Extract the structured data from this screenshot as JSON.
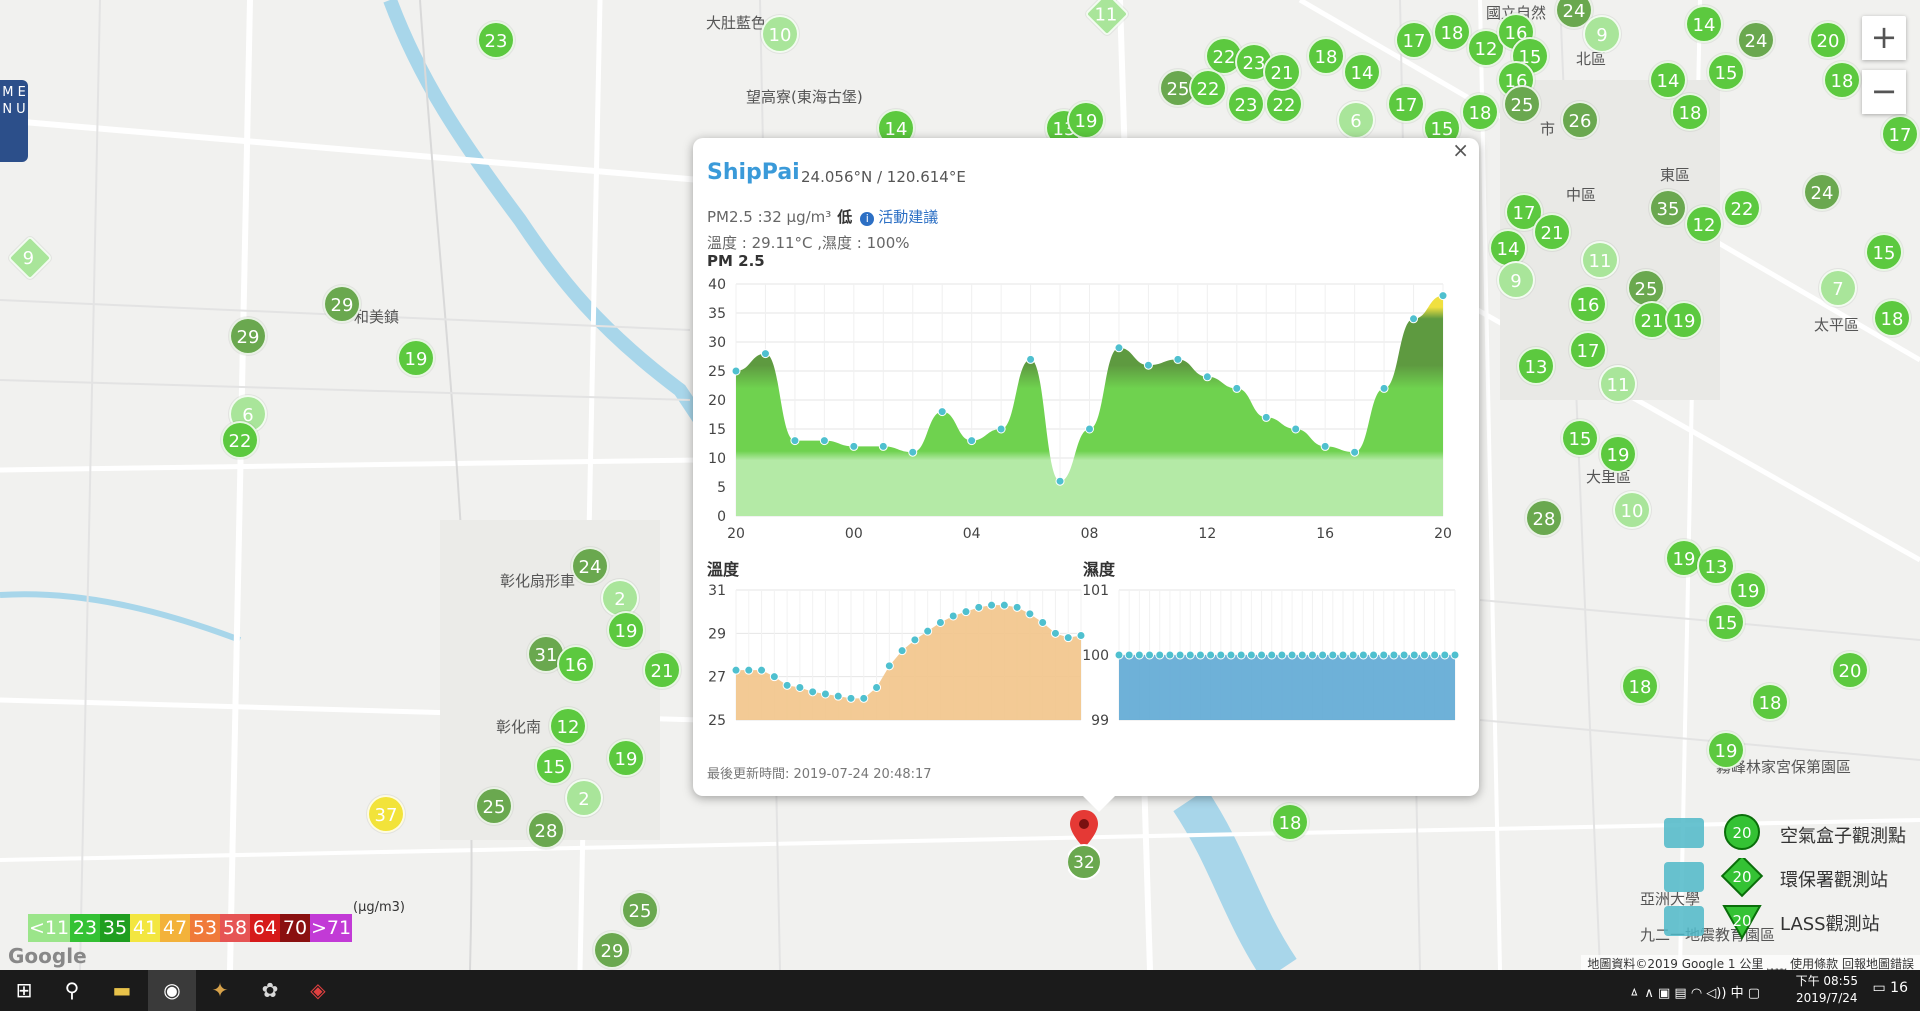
{
  "menu": {
    "label": "M E N U"
  },
  "zoom": {
    "in": "+",
    "out": "−"
  },
  "places": [
    {
      "text": "大肚藍色",
      "x": 706,
      "y": 12
    },
    {
      "text": "望高寮(東海古堡)",
      "x": 746,
      "y": 86
    },
    {
      "text": "和美鎮",
      "x": 354,
      "y": 306
    },
    {
      "text": "彰化扇形車",
      "x": 500,
      "y": 570
    },
    {
      "text": "彰化南",
      "x": 496,
      "y": 716
    },
    {
      "text": "北區",
      "x": 1576,
      "y": 48
    },
    {
      "text": "市",
      "x": 1540,
      "y": 118
    },
    {
      "text": "東區",
      "x": 1660,
      "y": 164
    },
    {
      "text": "中區",
      "x": 1566,
      "y": 184
    },
    {
      "text": "太平區",
      "x": 1814,
      "y": 314
    },
    {
      "text": "大里區",
      "x": 1586,
      "y": 466
    },
    {
      "text": "亞洲大學",
      "x": 1640,
      "y": 888
    },
    {
      "text": "九二一地震教育園區",
      "x": 1640,
      "y": 924
    },
    {
      "text": "霧峰林家宮保第園區",
      "x": 1716,
      "y": 756
    },
    {
      "text": "國立自然",
      "x": 1486,
      "y": 2
    }
  ],
  "markers": [
    {
      "v": "23",
      "x": 496,
      "y": 40,
      "c": "green"
    },
    {
      "v": "10",
      "x": 780,
      "y": 34,
      "c": "light"
    },
    {
      "v": "11",
      "x": 1107,
      "y": 14,
      "c": "light",
      "shape": "diamond"
    },
    {
      "v": "14",
      "x": 896,
      "y": 128,
      "c": "green"
    },
    {
      "v": "13",
      "x": 1064,
      "y": 128,
      "c": "green"
    },
    {
      "v": "19",
      "x": 1086,
      "y": 120,
      "c": "green"
    },
    {
      "v": "22",
      "x": 1224,
      "y": 56,
      "c": "green"
    },
    {
      "v": "23",
      "x": 1254,
      "y": 62,
      "c": "green"
    },
    {
      "v": "25",
      "x": 1178,
      "y": 88,
      "c": "dark"
    },
    {
      "v": "22",
      "x": 1208,
      "y": 88,
      "c": "green"
    },
    {
      "v": "23",
      "x": 1246,
      "y": 104,
      "c": "green"
    },
    {
      "v": "22",
      "x": 1284,
      "y": 104,
      "c": "green"
    },
    {
      "v": "21",
      "x": 1282,
      "y": 72,
      "c": "green"
    },
    {
      "v": "18",
      "x": 1326,
      "y": 56,
      "c": "green"
    },
    {
      "v": "14",
      "x": 1362,
      "y": 72,
      "c": "green"
    },
    {
      "v": "6",
      "x": 1356,
      "y": 120,
      "c": "light"
    },
    {
      "v": "17",
      "x": 1406,
      "y": 104,
      "c": "green"
    },
    {
      "v": "17",
      "x": 1414,
      "y": 40,
      "c": "green"
    },
    {
      "v": "18",
      "x": 1452,
      "y": 32,
      "c": "green"
    },
    {
      "v": "12",
      "x": 1486,
      "y": 48,
      "c": "green"
    },
    {
      "v": "16",
      "x": 1516,
      "y": 32,
      "c": "green"
    },
    {
      "v": "15",
      "x": 1530,
      "y": 56,
      "c": "green"
    },
    {
      "v": "16",
      "x": 1516,
      "y": 80,
      "c": "green"
    },
    {
      "v": "18",
      "x": 1480,
      "y": 112,
      "c": "green"
    },
    {
      "v": "25",
      "x": 1522,
      "y": 104,
      "c": "dark"
    },
    {
      "v": "15",
      "x": 1442,
      "y": 128,
      "c": "green"
    },
    {
      "v": "24",
      "x": 1574,
      "y": 10,
      "c": "dark"
    },
    {
      "v": "9",
      "x": 1602,
      "y": 34,
      "c": "light"
    },
    {
      "v": "26",
      "x": 1580,
      "y": 120,
      "c": "dark"
    },
    {
      "v": "14",
      "x": 1704,
      "y": 24,
      "c": "green"
    },
    {
      "v": "24",
      "x": 1756,
      "y": 40,
      "c": "dark"
    },
    {
      "v": "20",
      "x": 1828,
      "y": 40,
      "c": "green"
    },
    {
      "v": "18",
      "x": 1842,
      "y": 80,
      "c": "green"
    },
    {
      "v": "15",
      "x": 1726,
      "y": 72,
      "c": "green"
    },
    {
      "v": "14",
      "x": 1668,
      "y": 80,
      "c": "green"
    },
    {
      "v": "18",
      "x": 1690,
      "y": 112,
      "c": "green"
    },
    {
      "v": "17",
      "x": 1900,
      "y": 134,
      "c": "green"
    },
    {
      "v": "24",
      "x": 1822,
      "y": 192,
      "c": "dark"
    },
    {
      "v": "35",
      "x": 1668,
      "y": 208,
      "c": "dark"
    },
    {
      "v": "12",
      "x": 1704,
      "y": 224,
      "c": "green"
    },
    {
      "v": "22",
      "x": 1742,
      "y": 208,
      "c": "green"
    },
    {
      "v": "15",
      "x": 1884,
      "y": 252,
      "c": "green"
    },
    {
      "v": "7",
      "x": 1838,
      "y": 288,
      "c": "light"
    },
    {
      "v": "18",
      "x": 1892,
      "y": 318,
      "c": "green"
    },
    {
      "v": "17",
      "x": 1524,
      "y": 212,
      "c": "green"
    },
    {
      "v": "21",
      "x": 1552,
      "y": 232,
      "c": "green"
    },
    {
      "v": "14",
      "x": 1508,
      "y": 248,
      "c": "green"
    },
    {
      "v": "11",
      "x": 1600,
      "y": 260,
      "c": "light"
    },
    {
      "v": "9",
      "x": 1516,
      "y": 280,
      "c": "light"
    },
    {
      "v": "16",
      "x": 1588,
      "y": 304,
      "c": "green"
    },
    {
      "v": "25",
      "x": 1646,
      "y": 288,
      "c": "dark"
    },
    {
      "v": "21",
      "x": 1652,
      "y": 320,
      "c": "green"
    },
    {
      "v": "19",
      "x": 1684,
      "y": 320,
      "c": "green"
    },
    {
      "v": "17",
      "x": 1588,
      "y": 350,
      "c": "green"
    },
    {
      "v": "13",
      "x": 1536,
      "y": 366,
      "c": "green"
    },
    {
      "v": "11",
      "x": 1618,
      "y": 384,
      "c": "light"
    },
    {
      "v": "15",
      "x": 1580,
      "y": 438,
      "c": "green"
    },
    {
      "v": "19",
      "x": 1618,
      "y": 454,
      "c": "green"
    },
    {
      "v": "28",
      "x": 1544,
      "y": 518,
      "c": "dark"
    },
    {
      "v": "10",
      "x": 1632,
      "y": 510,
      "c": "light"
    },
    {
      "v": "19",
      "x": 1684,
      "y": 558,
      "c": "green"
    },
    {
      "v": "13",
      "x": 1716,
      "y": 566,
      "c": "green"
    },
    {
      "v": "19",
      "x": 1748,
      "y": 590,
      "c": "green"
    },
    {
      "v": "15",
      "x": 1726,
      "y": 622,
      "c": "green"
    },
    {
      "v": "18",
      "x": 1640,
      "y": 686,
      "c": "green"
    },
    {
      "v": "20",
      "x": 1850,
      "y": 670,
      "c": "green"
    },
    {
      "v": "18",
      "x": 1770,
      "y": 702,
      "c": "green"
    },
    {
      "v": "19",
      "x": 1726,
      "y": 750,
      "c": "green"
    },
    {
      "v": "18",
      "x": 1290,
      "y": 822,
      "c": "green"
    },
    {
      "v": "9",
      "x": 30,
      "y": 258,
      "c": "light",
      "shape": "diamond"
    },
    {
      "v": "29",
      "x": 342,
      "y": 304,
      "c": "dark"
    },
    {
      "v": "29",
      "x": 248,
      "y": 336,
      "c": "dark"
    },
    {
      "v": "19",
      "x": 416,
      "y": 358,
      "c": "green"
    },
    {
      "v": "6",
      "x": 248,
      "y": 414,
      "c": "light"
    },
    {
      "v": "22",
      "x": 240,
      "y": 440,
      "c": "green"
    },
    {
      "v": "24",
      "x": 590,
      "y": 566,
      "c": "dark"
    },
    {
      "v": "2",
      "x": 620,
      "y": 598,
      "c": "light"
    },
    {
      "v": "19",
      "x": 626,
      "y": 630,
      "c": "green"
    },
    {
      "v": "31",
      "x": 546,
      "y": 654,
      "c": "dark"
    },
    {
      "v": "16",
      "x": 576,
      "y": 664,
      "c": "green"
    },
    {
      "v": "21",
      "x": 662,
      "y": 670,
      "c": "green"
    },
    {
      "v": "12",
      "x": 568,
      "y": 726,
      "c": "green"
    },
    {
      "v": "15",
      "x": 554,
      "y": 766,
      "c": "green"
    },
    {
      "v": "2",
      "x": 584,
      "y": 798,
      "c": "light"
    },
    {
      "v": "19",
      "x": 626,
      "y": 758,
      "c": "green"
    },
    {
      "v": "25",
      "x": 494,
      "y": 806,
      "c": "dark"
    },
    {
      "v": "28",
      "x": 546,
      "y": 830,
      "c": "dark"
    },
    {
      "v": "37",
      "x": 386,
      "y": 814,
      "c": "yellow"
    },
    {
      "v": "25",
      "x": 640,
      "y": 910,
      "c": "dark"
    },
    {
      "v": "29",
      "x": 612,
      "y": 950,
      "c": "dark"
    }
  ],
  "popup": {
    "close": "×",
    "name": "ShipPai",
    "coords": "24.056°N / 120.614°E",
    "pm_text": "PM2.5 :32 μg/m³",
    "pm_level": "低",
    "info_icon": "i",
    "advice": "活動建議",
    "temp_hum": "溫度 : 29.11°C ,濕度 : 100%",
    "pm_title": "PM 2.5",
    "temp_title": "溫度",
    "hum_title": "濕度",
    "updated": "最後更新時間: 2019-07-24 20:48:17"
  },
  "pin_value": "32",
  "scale": [
    {
      "label": "<11",
      "color": "#9be58a"
    },
    {
      "label": "23",
      "color": "#34c234"
    },
    {
      "label": "35",
      "color": "#1f9e1f"
    },
    {
      "label": "41",
      "color": "#f3e640"
    },
    {
      "label": "47",
      "color": "#f3b23a"
    },
    {
      "label": "53",
      "color": "#f07a3a"
    },
    {
      "label": "58",
      "color": "#e65454"
    },
    {
      "label": "64",
      "color": "#d61a1a"
    },
    {
      "label": "70",
      "color": "#8a1010"
    },
    {
      "label": ">71",
      "color": "#c23ad6"
    }
  ],
  "scale_unit": "(μg/m3)",
  "legend": [
    {
      "value": "20",
      "text": "空氣盒子觀測點",
      "shape": "circle"
    },
    {
      "value": "20",
      "text": "環保署觀測站",
      "shape": "diamond"
    },
    {
      "value": "20",
      "text": "LASS觀測站",
      "shape": "triangle"
    }
  ],
  "google": "Google",
  "credits": "地圖資料©2019 Google   1 公里 ⎵⎵⎵⎵   使用條款   回報地圖錯誤",
  "taskbar": {
    "time": "下午 08:55",
    "date": "2019/7/24",
    "tray": "ㅿ  ∧  ▣  ▤  ◠  ◁))  中  ▢",
    "notif": "16"
  },
  "chart_data": [
    {
      "type": "area",
      "title": "PM 2.5",
      "xlabel": "",
      "ylabel": "",
      "x_ticks": [
        "20",
        "00",
        "04",
        "08",
        "12",
        "16",
        "20"
      ],
      "ylim": [
        0,
        40
      ],
      "y_ticks": [
        0,
        5,
        10,
        15,
        20,
        25,
        30,
        35,
        40
      ],
      "x_hours": [
        20,
        21,
        22,
        23,
        24,
        25,
        26,
        27,
        28,
        29,
        30,
        31,
        32,
        33,
        34,
        35,
        36,
        37,
        38,
        39,
        40,
        41,
        42,
        43,
        44
      ],
      "values": [
        25,
        28,
        13,
        13,
        12,
        12,
        11,
        18,
        13,
        15,
        27,
        6,
        15,
        29,
        26,
        27,
        24,
        22,
        17,
        15,
        12,
        11,
        22,
        34,
        38
      ],
      "band_colors": {
        "0-10": "#aee8a0",
        "10-23": "#6fd24f",
        "23-35": "#5a9a3e",
        "35-41": "#f3e640"
      }
    },
    {
      "type": "area",
      "title": "溫度",
      "xlabel": "",
      "ylabel": "",
      "ylim": [
        25,
        31
      ],
      "y_ticks": [
        25,
        27,
        29,
        31
      ],
      "values": [
        27.3,
        27.3,
        27.3,
        27.0,
        26.6,
        26.5,
        26.3,
        26.2,
        26.1,
        26.0,
        26.0,
        26.5,
        27.5,
        28.2,
        28.7,
        29.1,
        29.5,
        29.8,
        30.0,
        30.2,
        30.3,
        30.3,
        30.2,
        29.9,
        29.5,
        29.0,
        28.8,
        28.9
      ],
      "fill": "#f2c48a"
    },
    {
      "type": "area",
      "title": "濕度",
      "xlabel": "",
      "ylabel": "",
      "ylim": [
        99,
        101
      ],
      "y_ticks": [
        99,
        100,
        101
      ],
      "values": [
        100,
        100,
        100,
        100,
        100,
        100,
        100,
        100,
        100,
        100,
        100,
        100,
        100,
        100,
        100,
        100,
        100,
        100,
        100,
        100,
        100,
        100,
        100,
        100,
        100,
        100,
        100,
        100,
        100,
        100,
        100,
        100,
        100,
        100
      ],
      "fill": "#5ea9d4"
    }
  ]
}
